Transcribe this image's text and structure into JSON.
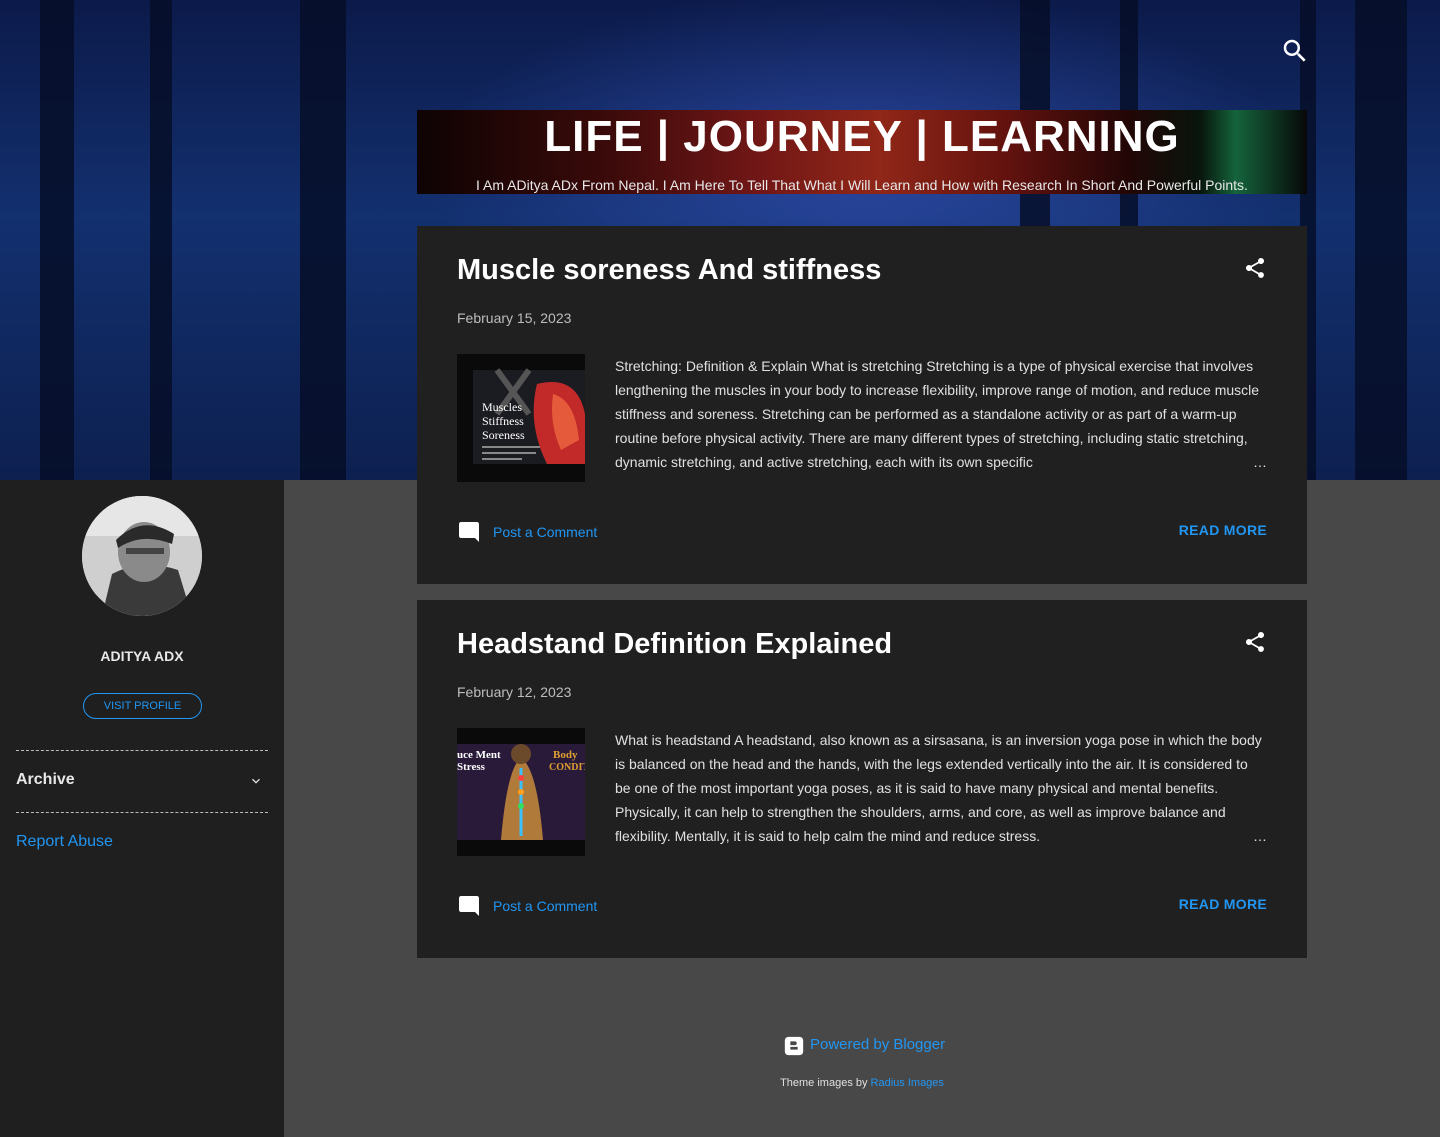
{
  "header": {
    "title": "LIFE | JOURNEY | LEARNING",
    "description": "I Am ADitya ADx From Nepal. I Am Here To Tell That What I Will Learn and How with Research In Short And Powerful Points.",
    "search_icon": "search-icon"
  },
  "sidebar": {
    "profile_name": "ADITYA ADX",
    "visit_profile": "VISIT PROFILE",
    "archive_label": "Archive",
    "report_abuse": "Report Abuse"
  },
  "posts": [
    {
      "title": "Muscle soreness And stiffness",
      "date": "February 15, 2023",
      "thumb_lines": [
        "Muscles",
        "Stiffness",
        "Soreness"
      ],
      "snippet": " Stretching: Definition & Explain  What is stretching Stretching is a type of physical exercise that involves lengthening the muscles in your body to increase flexibility, improve range of motion, and reduce muscle stiffness and soreness.  Stretching can be performed as a standalone activity or as part of a warm-up routine before physical activity.  There are many different types of stretching, including static stretching, dynamic stretching, and active stretching, each with its own specific",
      "ellipsis": "…",
      "comment_label": "Post a Comment",
      "read_more": "READ MORE"
    },
    {
      "title": "Headstand Definition Explained",
      "date": "February 12, 2023",
      "thumb_lines": [
        "uce Ment",
        "Stress",
        "Body",
        "CONDIT"
      ],
      "snippet": " What is headstand A headstand, also known as a sirsasana, is an inversion yoga pose in which the body is balanced on the head and the hands, with the legs extended vertically into the air. It is considered to be one of the most important yoga poses, as it is said to have many physical and mental benefits. Physically, it can help to strengthen the shoulders, arms, and core, as well as improve balance and flexibility. Mentally, it is said to help calm the mind and reduce stress.",
      "ellipsis": "…",
      "comment_label": "Post a Comment",
      "read_more": "READ MORE"
    }
  ],
  "footer": {
    "powered_by": "Powered by Blogger",
    "theme_prefix": "Theme images by ",
    "theme_link": "Radius Images"
  },
  "colors": {
    "accent": "#2196f3",
    "page_bg": "#484848",
    "card_bg": "#202020",
    "sidebar_bg": "#1f1f1f"
  }
}
